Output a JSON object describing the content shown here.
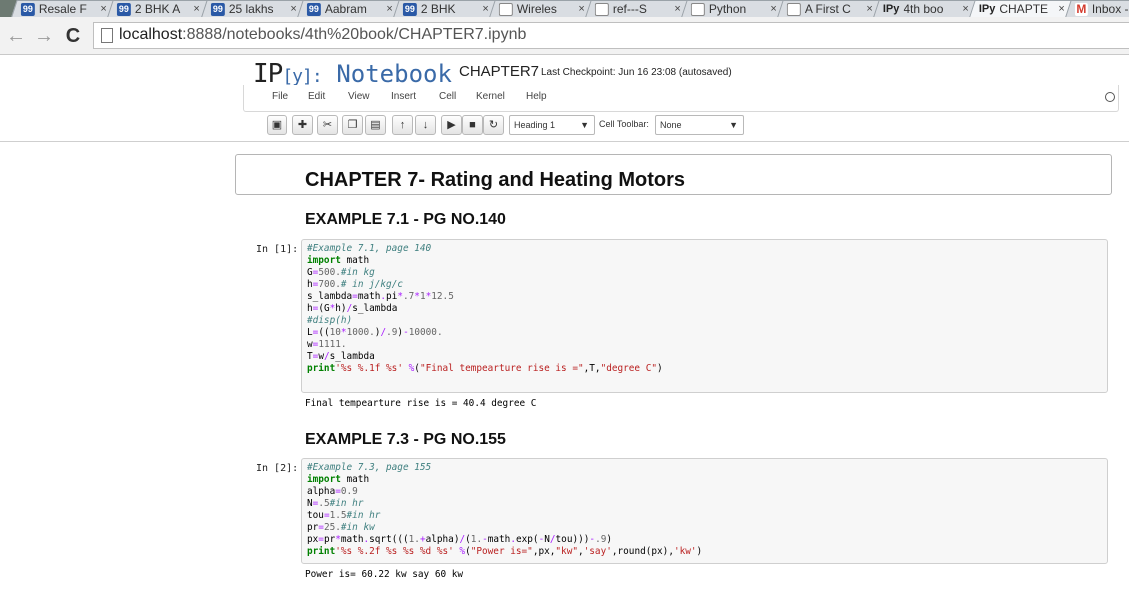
{
  "browser": {
    "tabs": [
      {
        "title": "Resale F",
        "favicon": "99"
      },
      {
        "title": "2 BHK A",
        "favicon": "99"
      },
      {
        "title": "25 lakhs",
        "favicon": "99"
      },
      {
        "title": "Aabram",
        "favicon": "99"
      },
      {
        "title": "2 BHK",
        "favicon": "99"
      },
      {
        "title": "Wireles",
        "favicon": "doc"
      },
      {
        "title": "ref---S",
        "favicon": "doc"
      },
      {
        "title": "Python",
        "favicon": "doc"
      },
      {
        "title": "A First C",
        "favicon": "doc"
      },
      {
        "title": "4th boo",
        "favicon": "IPy"
      },
      {
        "title": "CHAPTE",
        "favicon": "IPy"
      },
      {
        "title": "Inbox -",
        "favicon": "M"
      }
    ],
    "close_glyph": "×",
    "url_host": "localhost",
    "url_path": ":8888/notebooks/4th%20book/CHAPTER7.ipynb",
    "back_icon": "←",
    "forward_icon": "→",
    "reload_icon": "C"
  },
  "notebook": {
    "logo_prefix": "IP",
    "logo_y": "[y]:",
    "logo_suffix": "Notebook",
    "name": "CHAPTER7",
    "checkpoint": "Last Checkpoint: Jun 16 23:08 (autosaved)",
    "menu": [
      "File",
      "Edit",
      "View",
      "Insert",
      "Cell",
      "Kernel",
      "Help"
    ],
    "toolbar": {
      "cell_type": "Heading 1",
      "cell_toolbar_label": "Cell Toolbar:",
      "cell_toolbar_value": "None"
    }
  },
  "cells": {
    "title": "CHAPTER 7- Rating and Heating Motors",
    "ex1_heading": "EXAMPLE 7.1 - PG NO.140",
    "ex1_prompt": "In [1]:",
    "ex1_output": "Final tempearture rise is = 40.4 degree C",
    "ex2_heading": "EXAMPLE 7.3 - PG NO.155",
    "ex2_prompt": "In [2]:",
    "ex2_output": "Power is= 60.22 kw say 60 kw"
  }
}
